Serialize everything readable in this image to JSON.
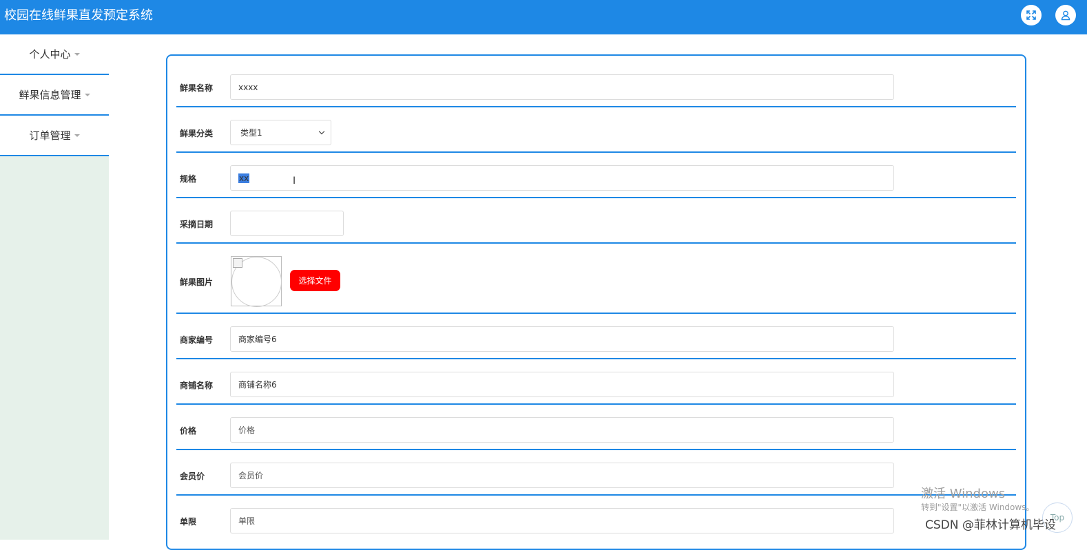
{
  "app": {
    "title": "校园在线鲜果直发预定系统"
  },
  "header": {
    "icons": [
      "expand-icon",
      "user-icon"
    ]
  },
  "sidebar": {
    "items": [
      {
        "label": "个人中心"
      },
      {
        "label": "鲜果信息管理"
      },
      {
        "label": "订单管理"
      }
    ]
  },
  "form": {
    "fruit_name": {
      "label": "鲜果名称",
      "value": "xxxx"
    },
    "category": {
      "label": "鲜果分类",
      "selected": "类型1"
    },
    "spec": {
      "label": "规格",
      "value": "xx"
    },
    "pick_date": {
      "label": "采摘日期",
      "value": ""
    },
    "image": {
      "label": "鲜果图片",
      "button": "选择文件"
    },
    "merchant_no": {
      "label": "商家编号",
      "value": "商家编号6"
    },
    "shop_name": {
      "label": "商铺名称",
      "value": "商铺名称6"
    },
    "price": {
      "label": "价格",
      "placeholder": "价格"
    },
    "member_price": {
      "label": "会员价",
      "placeholder": "会员价"
    },
    "limit": {
      "label": "单限",
      "placeholder": "单限"
    }
  },
  "overlay": {
    "activate_title": "激活 Windows",
    "activate_sub": "转到\"设置\"以激活 Windows。",
    "csdn": "CSDN @菲林计算机毕设",
    "top_button": "Top"
  },
  "colors": {
    "accent": "#1e88e5",
    "danger": "#ff0000",
    "sidebar_bg": "#e6f1ea"
  }
}
